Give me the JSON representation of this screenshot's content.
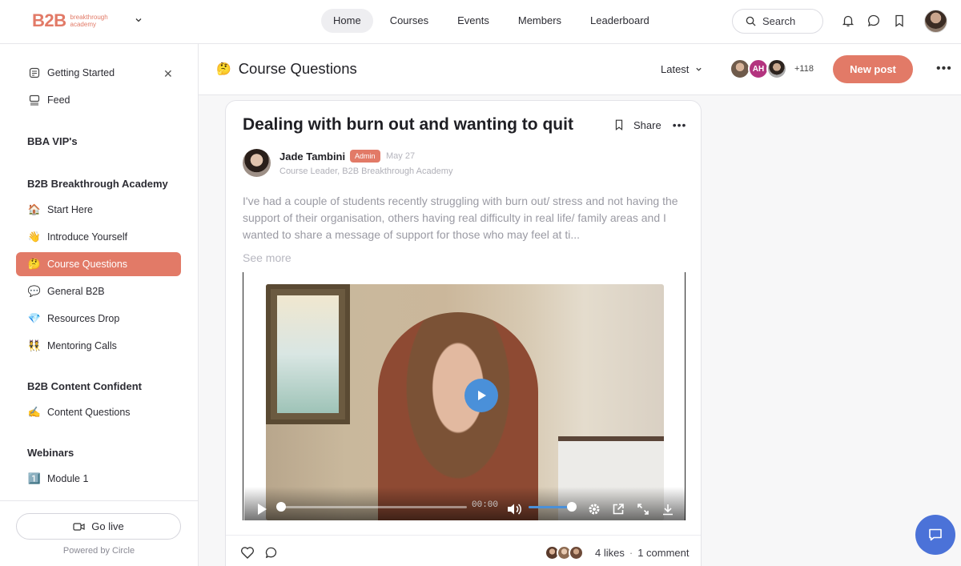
{
  "brand": {
    "name": "B2B",
    "tagline": "breakthrough academy",
    "accent": "#e27a67"
  },
  "nav": {
    "items": [
      "Home",
      "Courses",
      "Events",
      "Members",
      "Leaderboard"
    ],
    "active": "Home"
  },
  "search": {
    "label": "Search"
  },
  "sidebar": {
    "top_items": [
      {
        "label": "Getting Started",
        "icon": "checklist-icon"
      },
      {
        "label": "Feed",
        "icon": "feed-icon"
      }
    ],
    "sections": [
      {
        "title": "BBA VIP's",
        "items": []
      },
      {
        "title": "B2B Breakthrough Academy",
        "items": [
          {
            "emoji": "🏠",
            "label": "Start Here"
          },
          {
            "emoji": "👋",
            "label": "Introduce Yourself"
          },
          {
            "emoji": "🤔",
            "label": "Course Questions",
            "active": true
          },
          {
            "emoji": "💬",
            "label": "General B2B"
          },
          {
            "emoji": "💎",
            "label": "Resources Drop"
          },
          {
            "emoji": "👯",
            "label": "Mentoring Calls"
          }
        ]
      },
      {
        "title": "B2B Content Confident",
        "items": [
          {
            "emoji": "✍️",
            "label": "Content Questions"
          }
        ]
      },
      {
        "title": "Webinars",
        "items": [
          {
            "emoji": "1️⃣",
            "label": "Module 1"
          }
        ]
      }
    ],
    "go_live": "Go live",
    "powered_by": "Powered by Circle"
  },
  "space": {
    "emoji": "🤔",
    "title": "Course Questions",
    "sort": "Latest",
    "member_initials": "AH",
    "member_count": "+118",
    "new_post": "New post"
  },
  "post": {
    "title": "Dealing with burn out and wanting to quit",
    "share": "Share",
    "author": "Jade Tambini",
    "badge": "Admin",
    "date": "May 27",
    "role": "Course Leader, B2B Breakthrough Academy",
    "body": "I've had a couple of students recently struggling with burn out/ stress and not having the support of their organisation, others having real difficulty in real life/ family areas and I wanted to share a message of support for those who may feel at ti...",
    "see_more": "See more",
    "video": {
      "time": "00:00",
      "progress": 0,
      "volume": 1
    },
    "likes": "4 likes",
    "comments": "1 comment"
  }
}
